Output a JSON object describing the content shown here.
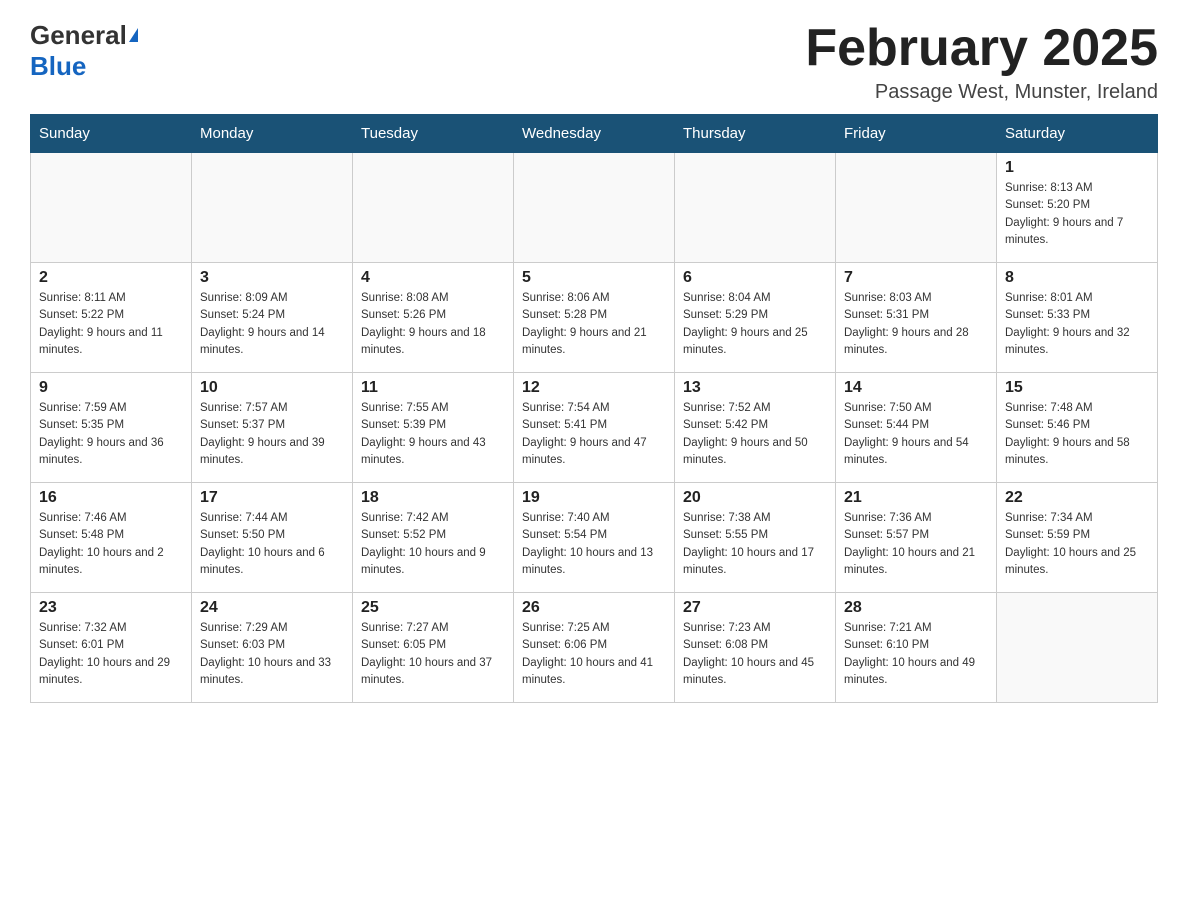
{
  "header": {
    "logo": {
      "general": "General",
      "blue": "Blue",
      "triangle": true
    },
    "title": "February 2025",
    "location": "Passage West, Munster, Ireland"
  },
  "calendar": {
    "days_of_week": [
      "Sunday",
      "Monday",
      "Tuesday",
      "Wednesday",
      "Thursday",
      "Friday",
      "Saturday"
    ],
    "weeks": [
      [
        {
          "day": "",
          "info": ""
        },
        {
          "day": "",
          "info": ""
        },
        {
          "day": "",
          "info": ""
        },
        {
          "day": "",
          "info": ""
        },
        {
          "day": "",
          "info": ""
        },
        {
          "day": "",
          "info": ""
        },
        {
          "day": "1",
          "info": "Sunrise: 8:13 AM\nSunset: 5:20 PM\nDaylight: 9 hours and 7 minutes."
        }
      ],
      [
        {
          "day": "2",
          "info": "Sunrise: 8:11 AM\nSunset: 5:22 PM\nDaylight: 9 hours and 11 minutes."
        },
        {
          "day": "3",
          "info": "Sunrise: 8:09 AM\nSunset: 5:24 PM\nDaylight: 9 hours and 14 minutes."
        },
        {
          "day": "4",
          "info": "Sunrise: 8:08 AM\nSunset: 5:26 PM\nDaylight: 9 hours and 18 minutes."
        },
        {
          "day": "5",
          "info": "Sunrise: 8:06 AM\nSunset: 5:28 PM\nDaylight: 9 hours and 21 minutes."
        },
        {
          "day": "6",
          "info": "Sunrise: 8:04 AM\nSunset: 5:29 PM\nDaylight: 9 hours and 25 minutes."
        },
        {
          "day": "7",
          "info": "Sunrise: 8:03 AM\nSunset: 5:31 PM\nDaylight: 9 hours and 28 minutes."
        },
        {
          "day": "8",
          "info": "Sunrise: 8:01 AM\nSunset: 5:33 PM\nDaylight: 9 hours and 32 minutes."
        }
      ],
      [
        {
          "day": "9",
          "info": "Sunrise: 7:59 AM\nSunset: 5:35 PM\nDaylight: 9 hours and 36 minutes."
        },
        {
          "day": "10",
          "info": "Sunrise: 7:57 AM\nSunset: 5:37 PM\nDaylight: 9 hours and 39 minutes."
        },
        {
          "day": "11",
          "info": "Sunrise: 7:55 AM\nSunset: 5:39 PM\nDaylight: 9 hours and 43 minutes."
        },
        {
          "day": "12",
          "info": "Sunrise: 7:54 AM\nSunset: 5:41 PM\nDaylight: 9 hours and 47 minutes."
        },
        {
          "day": "13",
          "info": "Sunrise: 7:52 AM\nSunset: 5:42 PM\nDaylight: 9 hours and 50 minutes."
        },
        {
          "day": "14",
          "info": "Sunrise: 7:50 AM\nSunset: 5:44 PM\nDaylight: 9 hours and 54 minutes."
        },
        {
          "day": "15",
          "info": "Sunrise: 7:48 AM\nSunset: 5:46 PM\nDaylight: 9 hours and 58 minutes."
        }
      ],
      [
        {
          "day": "16",
          "info": "Sunrise: 7:46 AM\nSunset: 5:48 PM\nDaylight: 10 hours and 2 minutes."
        },
        {
          "day": "17",
          "info": "Sunrise: 7:44 AM\nSunset: 5:50 PM\nDaylight: 10 hours and 6 minutes."
        },
        {
          "day": "18",
          "info": "Sunrise: 7:42 AM\nSunset: 5:52 PM\nDaylight: 10 hours and 9 minutes."
        },
        {
          "day": "19",
          "info": "Sunrise: 7:40 AM\nSunset: 5:54 PM\nDaylight: 10 hours and 13 minutes."
        },
        {
          "day": "20",
          "info": "Sunrise: 7:38 AM\nSunset: 5:55 PM\nDaylight: 10 hours and 17 minutes."
        },
        {
          "day": "21",
          "info": "Sunrise: 7:36 AM\nSunset: 5:57 PM\nDaylight: 10 hours and 21 minutes."
        },
        {
          "day": "22",
          "info": "Sunrise: 7:34 AM\nSunset: 5:59 PM\nDaylight: 10 hours and 25 minutes."
        }
      ],
      [
        {
          "day": "23",
          "info": "Sunrise: 7:32 AM\nSunset: 6:01 PM\nDaylight: 10 hours and 29 minutes."
        },
        {
          "day": "24",
          "info": "Sunrise: 7:29 AM\nSunset: 6:03 PM\nDaylight: 10 hours and 33 minutes."
        },
        {
          "day": "25",
          "info": "Sunrise: 7:27 AM\nSunset: 6:05 PM\nDaylight: 10 hours and 37 minutes."
        },
        {
          "day": "26",
          "info": "Sunrise: 7:25 AM\nSunset: 6:06 PM\nDaylight: 10 hours and 41 minutes."
        },
        {
          "day": "27",
          "info": "Sunrise: 7:23 AM\nSunset: 6:08 PM\nDaylight: 10 hours and 45 minutes."
        },
        {
          "day": "28",
          "info": "Sunrise: 7:21 AM\nSunset: 6:10 PM\nDaylight: 10 hours and 49 minutes."
        },
        {
          "day": "",
          "info": ""
        }
      ]
    ]
  }
}
